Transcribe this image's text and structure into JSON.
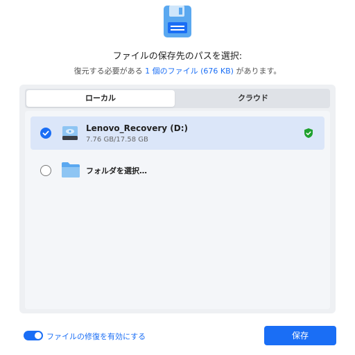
{
  "header": {
    "icon": "floppy-disk-icon",
    "title": "ファイルの保存先のパスを選択:",
    "subtitle_prefix": "復元する必要がある",
    "subtitle_count": "1 個のファイル (676 KB)",
    "subtitle_suffix": "があります。"
  },
  "tabs": [
    {
      "label": "ローカル",
      "active": true
    },
    {
      "label": "クラウド",
      "active": false
    }
  ],
  "locations": [
    {
      "name": "Lenovo_Recovery (D:)",
      "size": "7.76 GB/17.58 GB",
      "selected": true,
      "icon": "drive-icon",
      "status_icon": "shield-check-icon"
    },
    {
      "name": "フォルダを選択…",
      "selected": false,
      "icon": "folder-icon"
    }
  ],
  "footer": {
    "toggle_label": "ファイルの修復を有効にする",
    "toggle_on": true,
    "save_label": "保存"
  },
  "colors": {
    "accent": "#1a6ef5",
    "selected_row": "#dbe6f9",
    "shield": "#1fa12e"
  }
}
